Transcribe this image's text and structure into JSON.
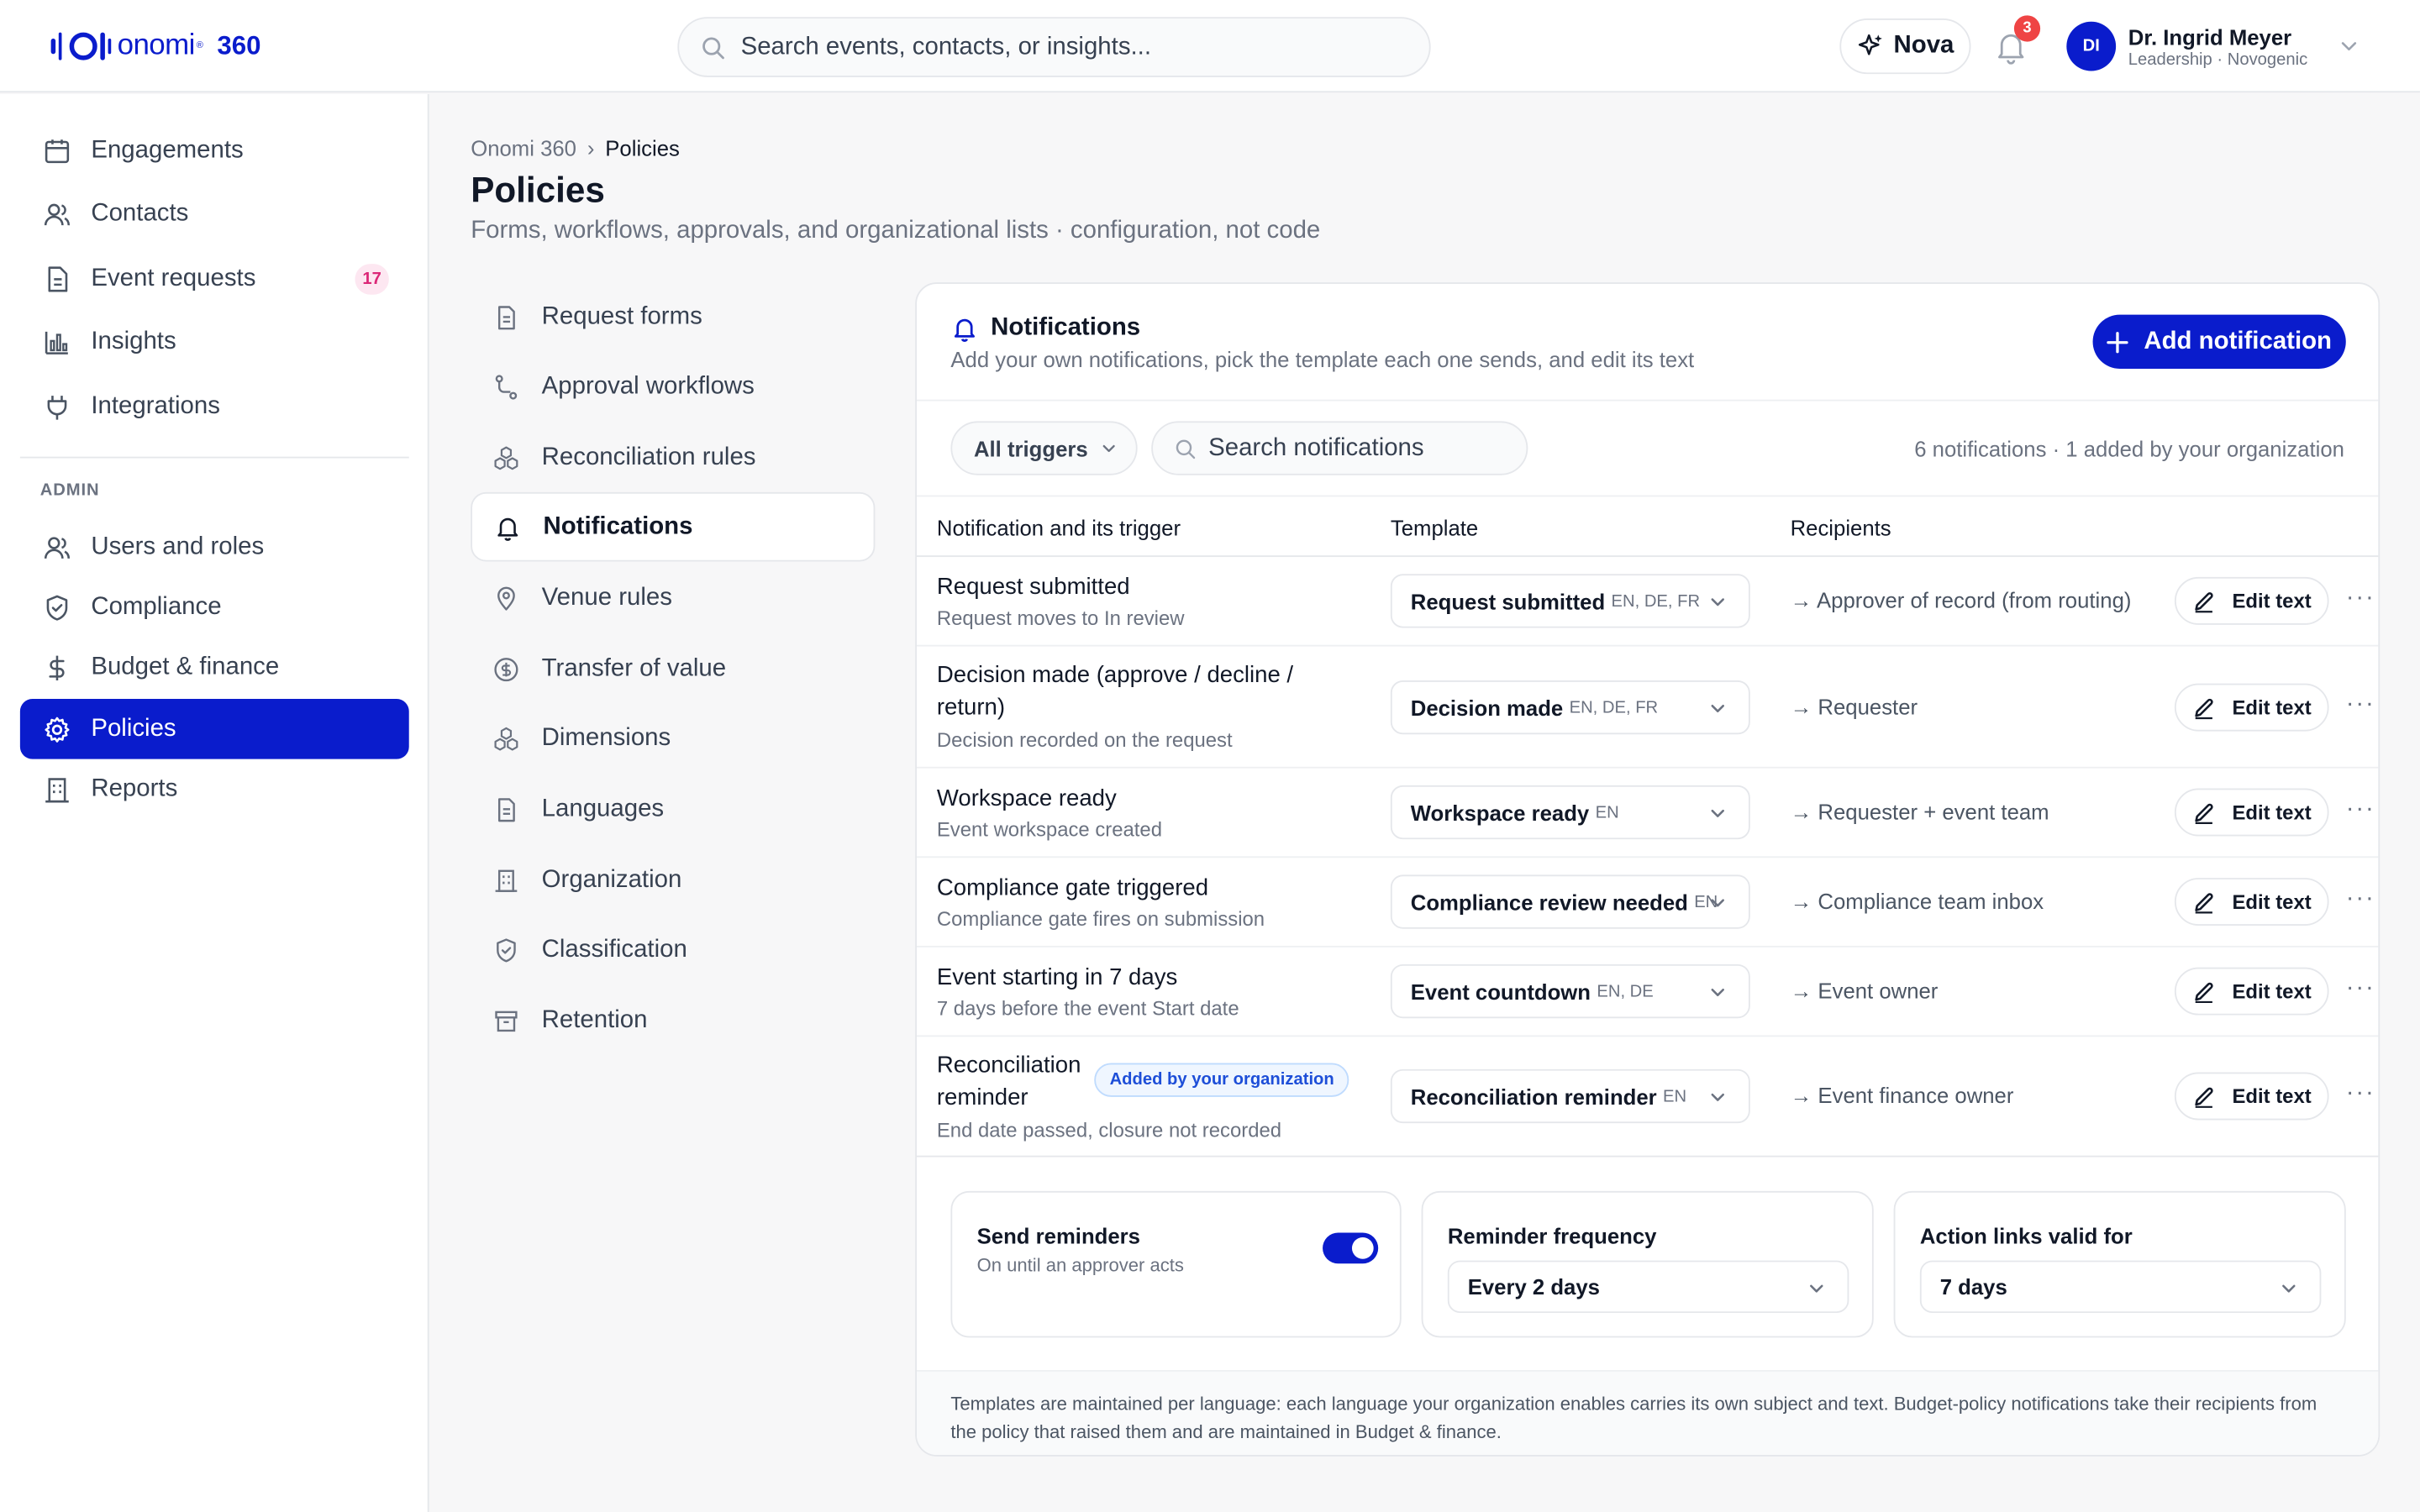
{
  "app": {
    "brand": "onomi",
    "reg": "®",
    "suffix": "360",
    "search_placeholder": "Search events, contacts, or insights...",
    "nova_label": "Nova",
    "notif_count": "3",
    "user": {
      "initials": "DI",
      "name": "Dr. Ingrid Meyer",
      "role": "Leadership · Novogenic"
    }
  },
  "sidebar": {
    "items": [
      {
        "label": "Engagements",
        "icon": "calendar-icon"
      },
      {
        "label": "Contacts",
        "icon": "users-icon"
      },
      {
        "label": "Event requests",
        "icon": "document-icon",
        "badge": "17"
      },
      {
        "label": "Insights",
        "icon": "bar-chart-icon"
      },
      {
        "label": "Integrations",
        "icon": "plug-icon"
      }
    ],
    "admin_label": "ADMIN",
    "admin_items": [
      {
        "label": "Users and roles",
        "icon": "users-icon"
      },
      {
        "label": "Compliance",
        "icon": "shield-icon"
      },
      {
        "label": "Budget & finance",
        "icon": "dollar-icon"
      },
      {
        "label": "Policies",
        "icon": "gear-icon",
        "active": true
      },
      {
        "label": "Reports",
        "icon": "building-icon"
      }
    ]
  },
  "breadcrumb": {
    "root": "Onomi 360",
    "sep": "›",
    "current": "Policies"
  },
  "page": {
    "title": "Policies",
    "subtitle": "Forms, workflows, approvals, and organizational lists · configuration, not code"
  },
  "subnav": [
    {
      "label": "Request forms",
      "icon": "document-icon"
    },
    {
      "label": "Approval workflows",
      "icon": "workflow-icon"
    },
    {
      "label": "Reconciliation rules",
      "icon": "cubes-icon"
    },
    {
      "label": "Notifications",
      "icon": "bell-icon",
      "active": true
    },
    {
      "label": "Venue rules",
      "icon": "pin-icon"
    },
    {
      "label": "Transfer of value",
      "icon": "coin-icon"
    },
    {
      "label": "Dimensions",
      "icon": "cubes-icon"
    },
    {
      "label": "Languages",
      "icon": "document-icon"
    },
    {
      "label": "Organization",
      "icon": "building-icon"
    },
    {
      "label": "Classification",
      "icon": "shield-icon"
    },
    {
      "label": "Retention",
      "icon": "archive-icon"
    }
  ],
  "panel": {
    "title": "Notifications",
    "subtitle": "Add your own notifications, pick the template each one sends, and edit its text",
    "add_button": "Add notification",
    "trigger_filter": "All triggers",
    "search_placeholder": "Search notifications",
    "count_text": "6 notifications · 1 added by your organization",
    "columns": [
      "Notification and its trigger",
      "Template",
      "Recipients"
    ],
    "edit_label": "Edit text",
    "more_label": "···",
    "rows": [
      {
        "title": "Request submitted",
        "title2": "",
        "sub": "Request moves to In review",
        "template": "Request submitted",
        "langs": "EN, DE, FR",
        "recipients": "→ Approver of record (from routing)"
      },
      {
        "title": "Decision made (approve / decline /",
        "title2": "return)",
        "sub": "Decision recorded on the request",
        "template": "Decision made",
        "langs": "EN, DE, FR",
        "recipients": "→ Requester"
      },
      {
        "title": "Workspace ready",
        "title2": "",
        "sub": "Event workspace created",
        "template": "Workspace ready",
        "langs": "EN",
        "recipients": "→ Requester + event team"
      },
      {
        "title": "Compliance gate triggered",
        "title2": "",
        "sub": "Compliance gate fires on submission",
        "template": "Compliance review needed",
        "langs": "EN",
        "recipients": "→ Compliance team inbox"
      },
      {
        "title": "Event starting in 7 days",
        "title2": "",
        "sub": "7 days before the event Start date",
        "template": "Event countdown",
        "langs": "EN, DE",
        "recipients": "→ Event owner"
      },
      {
        "title": "Reconciliation",
        "title2": "reminder",
        "sub": "End date passed, closure not recorded",
        "badge": "Added by your organization",
        "template": "Reconciliation reminder",
        "langs": "EN",
        "recipients": "→ Event finance owner"
      }
    ],
    "settings": {
      "reminders": {
        "title": "Send reminders",
        "sub": "On until an approver acts",
        "enabled": true
      },
      "frequency": {
        "title": "Reminder frequency",
        "value": "Every 2 days"
      },
      "links": {
        "title": "Action links valid for",
        "value": "7 days"
      }
    },
    "footnote": "Templates are maintained per language: each language your organization enables carries its own subject and text. Budget-policy notifications take their recipients from the policy that raised them and are maintained in Budget & finance."
  },
  "colors": {
    "accent": "#0a1ccc",
    "badge_red": "#ef4444",
    "badge_pink": "#db2777"
  }
}
